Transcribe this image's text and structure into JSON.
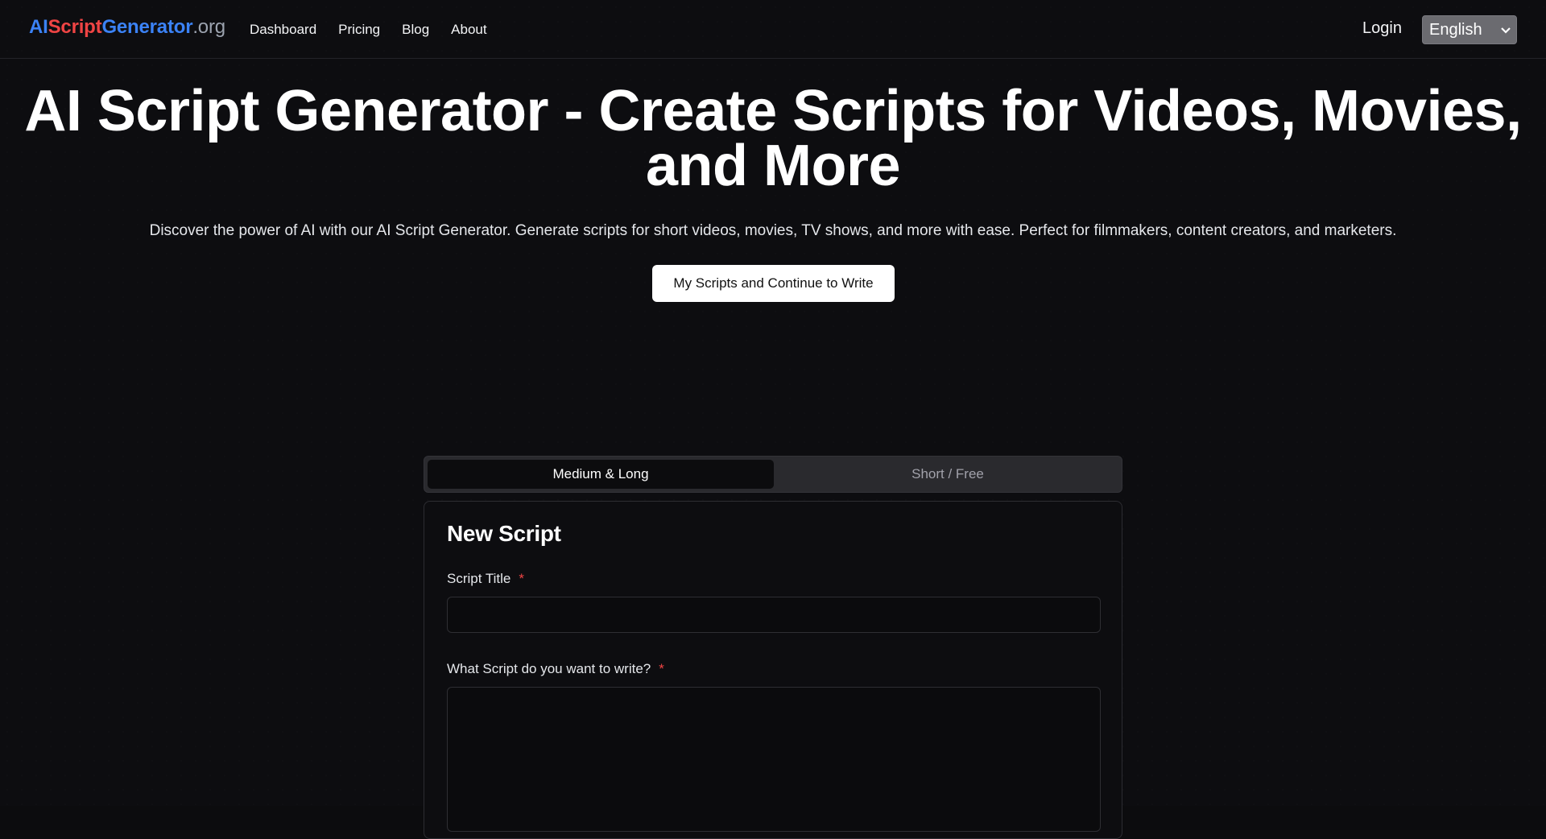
{
  "header": {
    "logo": {
      "part1": "AI",
      "part2": "Script",
      "part3": "Generator",
      "part4": ".org"
    },
    "nav": [
      "Dashboard",
      "Pricing",
      "Blog",
      "About"
    ],
    "login_label": "Login",
    "language_selected": "English"
  },
  "hero": {
    "title_line1": "AI Script Generator - Create Scripts for Videos, Movies,",
    "title_line2": "and More",
    "subtitle": "Discover the power of AI with our AI Script Generator. Generate scripts for short videos, movies, TV shows, and more with ease. Perfect for filmmakers, content creators, and marketers.",
    "cta_label": "My Scripts and Continue to Write"
  },
  "tabs": [
    {
      "label": "Medium & Long",
      "active": true
    },
    {
      "label": "Short / Free",
      "active": false
    }
  ],
  "form": {
    "title": "New Script",
    "field_title_label": "Script Title",
    "field_prompt_label": "What Script do you want to write?",
    "required_mark": "*",
    "field_title_value": "",
    "field_prompt_value": ""
  },
  "colors": {
    "background": "#0d0d10",
    "logo_blue": "#3b82f6",
    "logo_red": "#ef4444",
    "required": "#ef4444"
  }
}
